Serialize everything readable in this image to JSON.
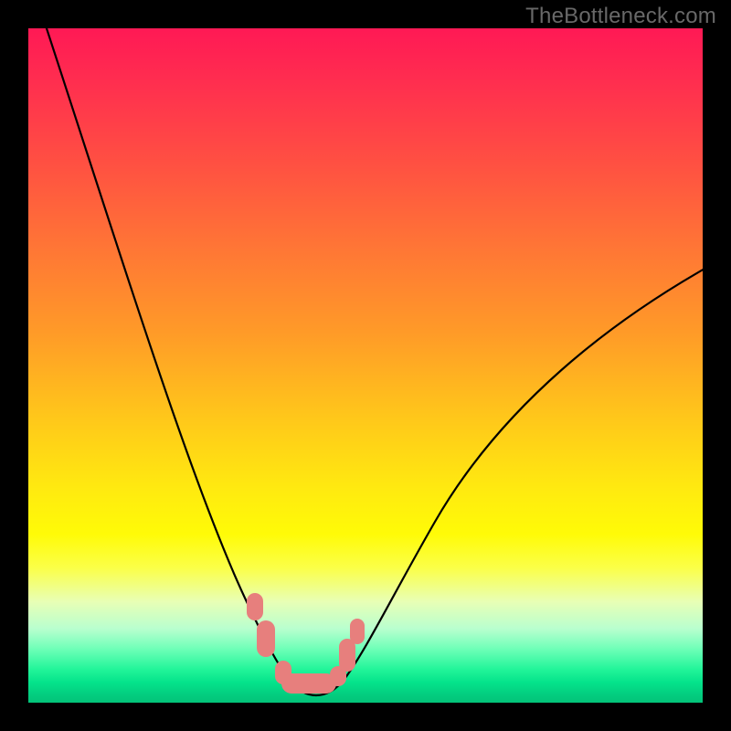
{
  "watermark": "TheBottleneck.com",
  "colors": {
    "page_bg": "#000000",
    "watermark_text": "#686868",
    "curve_stroke": "#000000",
    "marker_fill": "#e77f7d",
    "gradient_stops": [
      "#ff1955",
      "#ff2e4f",
      "#ff5042",
      "#ff7735",
      "#ff9a28",
      "#ffc81a",
      "#ffe910",
      "#fffb07",
      "#fbff48",
      "#e8ffb5",
      "#b9ffcf",
      "#6fffb8",
      "#23f59a",
      "#04e38b",
      "#03cb7e",
      "#03c479"
    ]
  },
  "chart_data": {
    "type": "line",
    "title": "",
    "xlabel": "",
    "ylabel": "",
    "xlim": [
      0,
      100
    ],
    "ylim": [
      0,
      100
    ],
    "legend": false,
    "grid": false,
    "series": [
      {
        "name": "bottleneck-curve-left",
        "x": [
          2,
          5,
          8,
          11,
          14,
          17,
          20,
          23,
          26,
          29,
          31,
          33,
          35,
          36.5,
          38
        ],
        "y": [
          100,
          91,
          82,
          73,
          64,
          55,
          46,
          38,
          30,
          23,
          17,
          12,
          8,
          5,
          3
        ]
      },
      {
        "name": "bottleneck-curve-floor",
        "x": [
          38,
          40,
          42,
          44,
          46
        ],
        "y": [
          3,
          1.5,
          1,
          1.5,
          3
        ]
      },
      {
        "name": "bottleneck-curve-right",
        "x": [
          46,
          49,
          53,
          58,
          64,
          71,
          79,
          88,
          98,
          100
        ],
        "y": [
          3,
          7,
          13,
          21,
          30,
          39,
          48,
          56,
          63,
          65
        ]
      }
    ],
    "highlight_regions": [
      {
        "name": "left-cluster",
        "x_range": [
          32.5,
          36.5
        ],
        "approx_center_y": 9
      },
      {
        "name": "floor-cluster",
        "x_range": [
          37.5,
          44.5
        ],
        "approx_center_y": 2
      },
      {
        "name": "right-cluster",
        "x_range": [
          45.5,
          49.0
        ],
        "approx_center_y": 6
      }
    ],
    "annotations": []
  }
}
